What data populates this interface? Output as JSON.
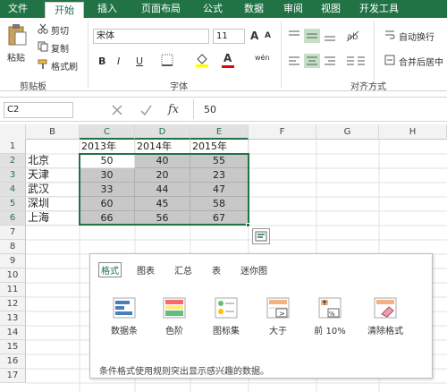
{
  "tabs": [
    "文件",
    "开始",
    "插入",
    "页面布局",
    "公式",
    "数据",
    "审阅",
    "视图",
    "开发工具"
  ],
  "ribbon": {
    "paste_label": "粘贴",
    "cut_label": "剪切",
    "copy_label": "复制",
    "format_painter_label": "格式刷",
    "clipboard_group": "剪贴板",
    "font_name": "宋体",
    "font_size": "11",
    "font_group": "字体",
    "bold": "B",
    "italic": "I",
    "underline": "U",
    "font_color_glyph": "A",
    "grow_font": "A",
    "shrink_font": "A",
    "phonetic": "wén",
    "wrap_text_label": "自动换行",
    "merge_label": "合并后居中",
    "alignment_group": "对齐方式"
  },
  "formula_bar": {
    "name_box": "C2",
    "fx": "fx",
    "value": "50"
  },
  "columns": [
    "B",
    "C",
    "D",
    "E",
    "F",
    "G",
    "H"
  ],
  "rows": [
    "1",
    "2",
    "3",
    "4",
    "5",
    "6",
    "7",
    "8",
    "9",
    "10",
    "11",
    "12",
    "13",
    "14",
    "15",
    "16",
    "17"
  ],
  "headers": [
    "2013年",
    "2014年",
    "2015年"
  ],
  "cities": [
    "北京",
    "天津",
    "武汉",
    "深圳",
    "上海"
  ],
  "values": [
    [
      50,
      40,
      55
    ],
    [
      30,
      20,
      23
    ],
    [
      33,
      44,
      47
    ],
    [
      60,
      45,
      58
    ],
    [
      66,
      56,
      67
    ]
  ],
  "quick_analysis": {
    "tabs": [
      "格式",
      "图表",
      "汇总",
      "表",
      "迷你图"
    ],
    "items": [
      "数据条",
      "色阶",
      "图标集",
      "大于",
      "前 10%",
      "清除格式"
    ],
    "description": "条件格式使用规则突出显示感兴趣的数据。",
    "active_tab": "格式"
  },
  "colors": {
    "accent": "#217346",
    "selection_fill": "#c8c8c8"
  }
}
